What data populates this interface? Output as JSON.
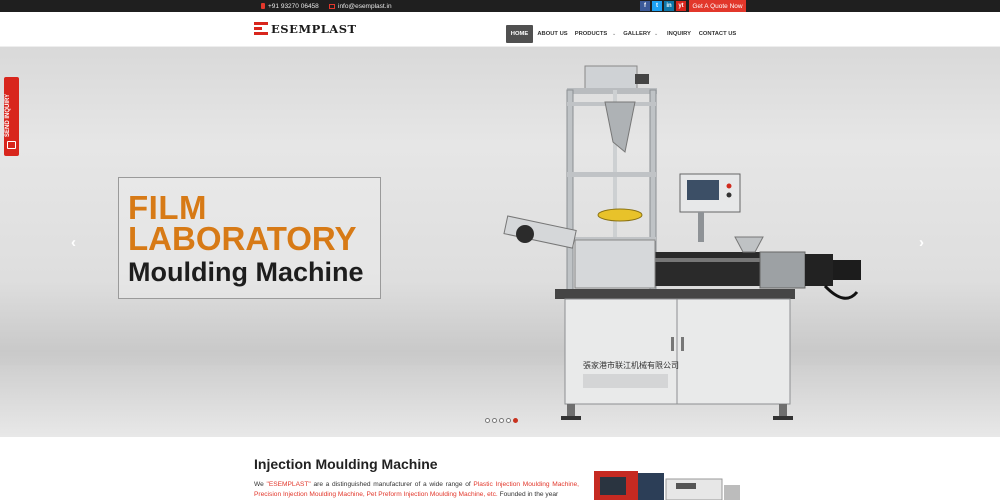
{
  "topbar": {
    "phone": "+91 93270 06458",
    "email": "info@esemplast.in",
    "social": [
      "f",
      "t",
      "in",
      "yt"
    ],
    "quote_button": "Get A Quote Now"
  },
  "brand": {
    "name": "ESEMPLAST"
  },
  "nav": {
    "home": "HOME",
    "about": "ABOUT US",
    "products": "PRODUCTS",
    "gallery": "GALLERY",
    "inquiry": "INQUIRY",
    "contact": "CONTACT US"
  },
  "side_tab": {
    "label": "SEND INQUIRY"
  },
  "hero": {
    "line1": "FILM",
    "line2": "LABORATORY",
    "line3": "Moulding Machine",
    "slide_count": 5,
    "active_slide": 5,
    "machine_label": "張家港市联江机械有限公司"
  },
  "section": {
    "title": "Injection Moulding Machine",
    "p_we": "We ",
    "p_brand": "\"ESEMPLAST\"",
    "p_mid": " are a distinguished manufacturer of a wide range of ",
    "p_link1": "Plastic Injection Moulding Machine,",
    "p_sp": " ",
    "p_link2": "Precision Injection Moulding Machine,",
    "p_link3": "Pet Preform Injection Moulding Machine, etc.",
    "p_end": " Founded in the year"
  },
  "colors": {
    "accent": "#e2372b",
    "hero_text": "#d77a16"
  }
}
